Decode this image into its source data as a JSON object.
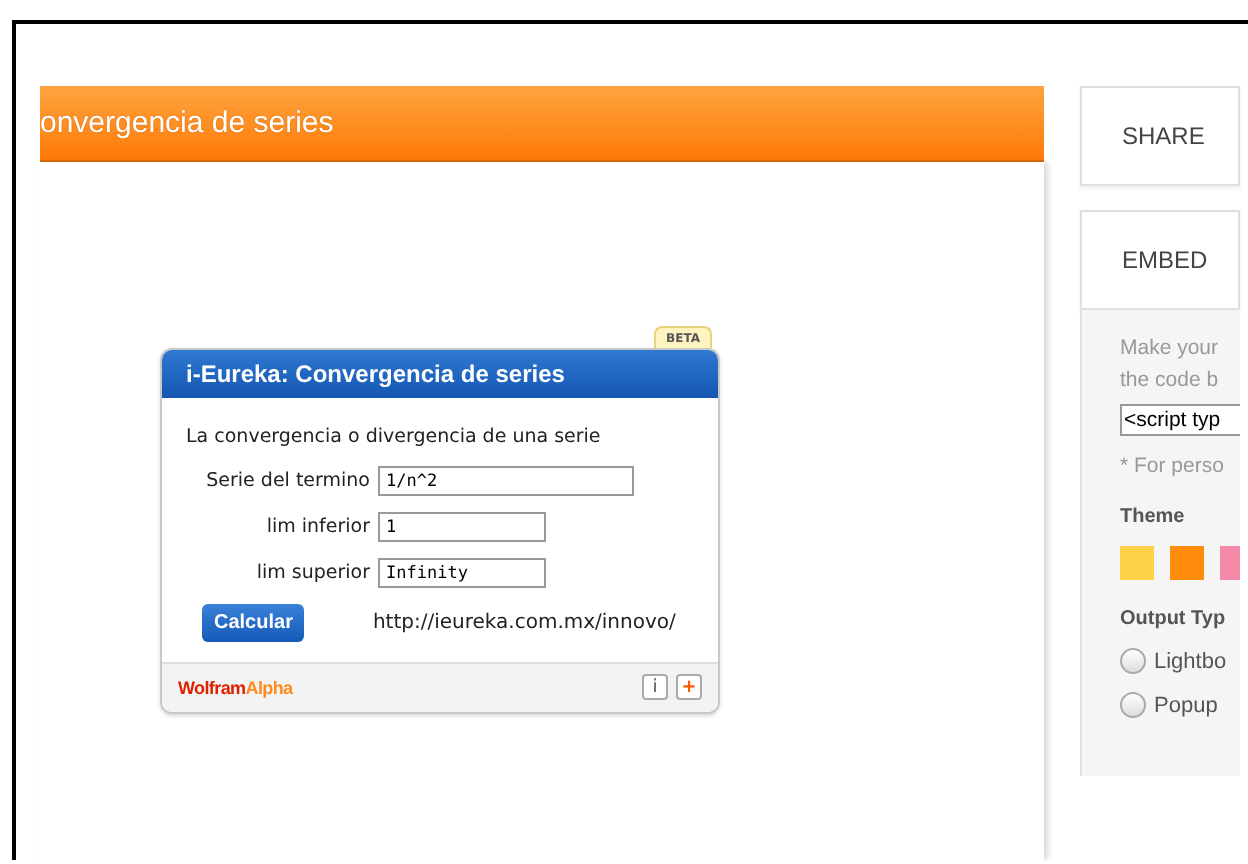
{
  "page_header": {
    "title": "onvergencia de series"
  },
  "widget": {
    "badge": "BETA",
    "title": "i-Eureka: Convergencia de series",
    "description": "La convergencia o divergencia de una serie",
    "fields": [
      {
        "label": "Serie del termino",
        "value": "1/n^2",
        "kind": "wide"
      },
      {
        "label": "lim inferior",
        "value": "1",
        "kind": "short"
      },
      {
        "label": "lim superior",
        "value": "Infinity",
        "kind": "short"
      }
    ],
    "button": "Calcular",
    "url": "http://ieureka.com.mx/innovo/",
    "footer": {
      "brand_first": "Wolfram",
      "brand_second": "Alpha",
      "info": "i",
      "add": "+"
    }
  },
  "sidebar": {
    "share": "SHARE",
    "embed": {
      "title": "EMBED",
      "intro_lines": [
        "Make your",
        "the code b"
      ],
      "code": "<script typ",
      "note": "* For perso",
      "theme_label": "Theme",
      "themes": [
        {
          "color": "#ffd04a"
        },
        {
          "color": "#ff8c0a"
        },
        {
          "color": "#f48aa8"
        }
      ],
      "output_label": "Output Typ",
      "outputs": [
        {
          "label": "Lightbo",
          "selected": false
        },
        {
          "label": "Popup",
          "selected": false
        }
      ]
    }
  }
}
